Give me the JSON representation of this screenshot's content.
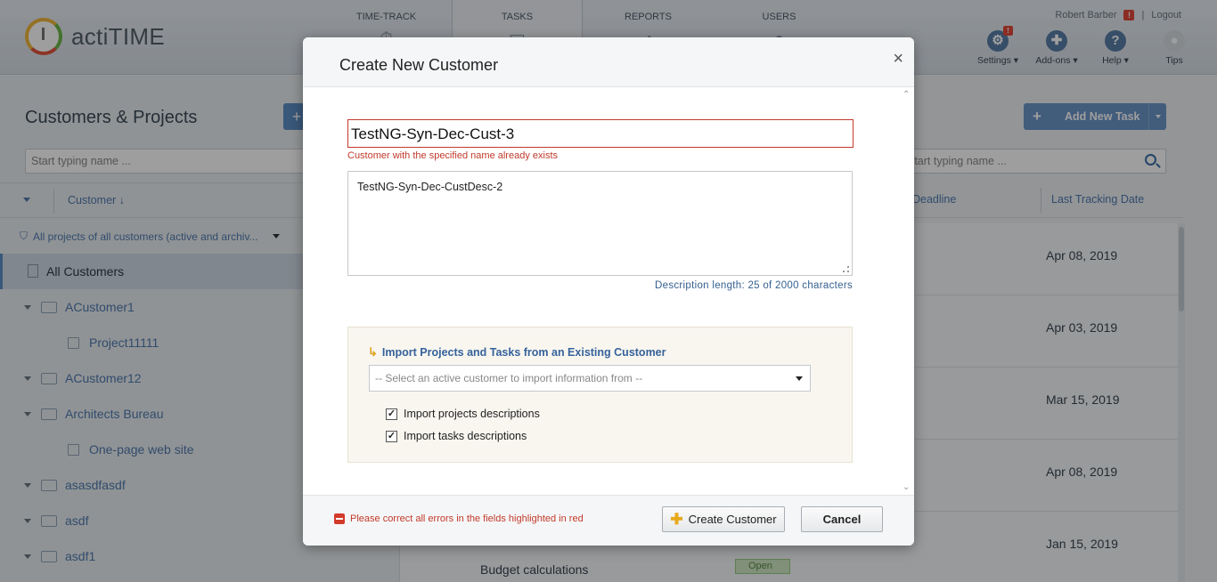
{
  "app": {
    "name": "actiTIME"
  },
  "nav": {
    "tabs": [
      {
        "label": "TIME-TRACK"
      },
      {
        "label": "TASKS"
      },
      {
        "label": "REPORTS"
      },
      {
        "label": "USERS"
      }
    ]
  },
  "user": {
    "name": "Robert Barber",
    "alert": "!",
    "logout": "Logout"
  },
  "tools": {
    "settings": "Settings",
    "addons": "Add-ons",
    "help": "Help",
    "tips": "Tips"
  },
  "left": {
    "title": "Customers & Projects",
    "add_glyph": "+",
    "search_placeholder": "Start typing name ...",
    "column": "Customer",
    "filter": "All projects of all customers (active and archiv...",
    "tree": [
      {
        "label": "All Customers"
      },
      {
        "label": "ACustomer1"
      },
      {
        "label": "Project11111"
      },
      {
        "label": "ACustomer12"
      },
      {
        "label": "Architects Bureau"
      },
      {
        "label": "One-page web site"
      },
      {
        "label": "asasdfasdf"
      },
      {
        "label": "asdf"
      },
      {
        "label": "asdf1"
      }
    ]
  },
  "right": {
    "add_task": "Add New Task",
    "search_placeholder": "Start typing name ...",
    "col_deadline": "Deadline",
    "col_last_tracking": "Last Tracking Date",
    "rows": [
      {
        "date": "Apr 08, 2019"
      },
      {
        "date": "Apr 03, 2019"
      },
      {
        "date": "Mar 15, 2019"
      },
      {
        "date": "Apr 08, 2019"
      },
      {
        "date": "Jan 15, 2019",
        "task": "Budget calculations",
        "status": "Open"
      }
    ]
  },
  "modal": {
    "title": "Create New Customer",
    "close": "×",
    "name_value": "TestNG-Syn-Dec-Cust-3",
    "name_error": "Customer with the specified name already exists",
    "description": "TestNG-Syn-Dec-CustDesc-2",
    "description_count": "Description length: 25 of 2000 characters",
    "import": {
      "title": "Import Projects and Tasks from an Existing Customer",
      "select_placeholder": "-- Select an active customer to import information from --",
      "opt_projects": "Import projects descriptions",
      "opt_tasks": "Import tasks descriptions",
      "projects_checked": true,
      "tasks_checked": true
    },
    "footer_error": "Please correct all errors in the fields highlighted in red",
    "create_btn": "Create Customer",
    "cancel_btn": "Cancel"
  }
}
